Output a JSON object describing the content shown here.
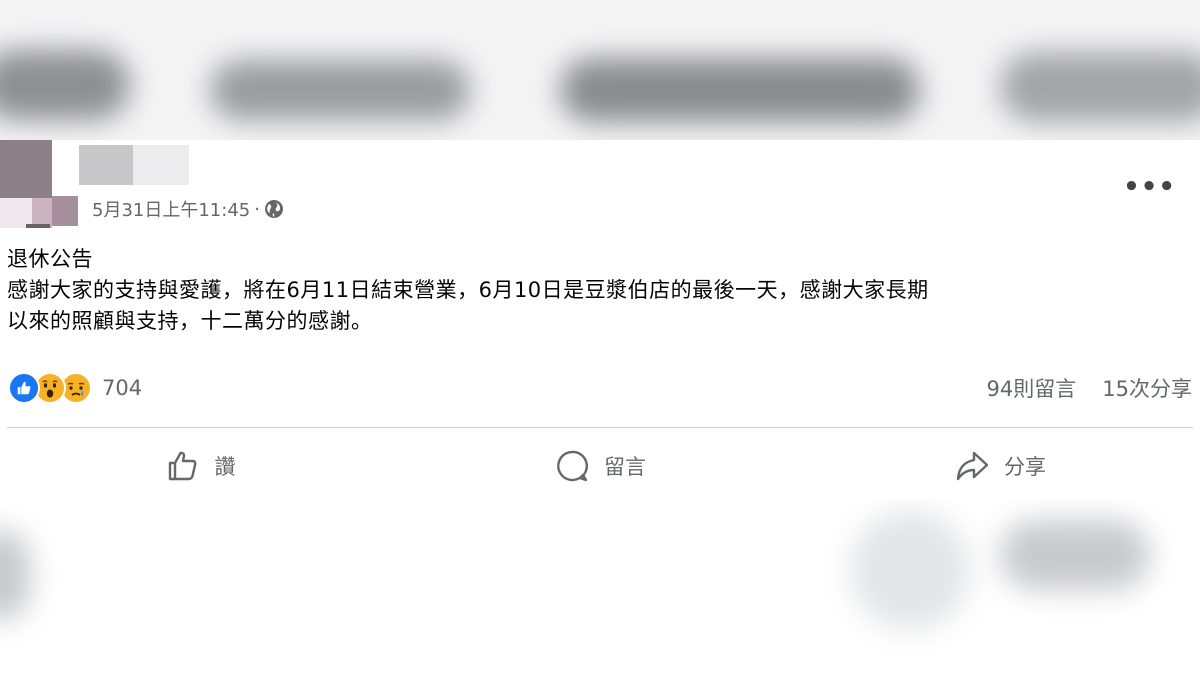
{
  "post": {
    "timestamp": "5月31日上午11:45",
    "separator": "·",
    "privacy_icon": "globe-icon",
    "more_icon": "more-horizontal-icon",
    "content_lines": [
      "退休公告",
      "感謝大家的支持與愛護，將在6月11日結束營業，6月10日是豆漿伯店的最後一天，感謝大家長期",
      "以來的照顧與支持，十二萬分的感謝。"
    ]
  },
  "reactions": {
    "icons": [
      "like-reaction-icon",
      "wow-reaction-icon",
      "sad-reaction-icon"
    ],
    "count": "704",
    "comments": "94則留言",
    "shares": "15次分享"
  },
  "actions": {
    "like_label": "讚",
    "comment_label": "留言",
    "share_label": "分享"
  },
  "colors": {
    "like_blue": "#1877f2",
    "emoji_yellow": "#f7b125",
    "secondary_text": "#65676b"
  }
}
